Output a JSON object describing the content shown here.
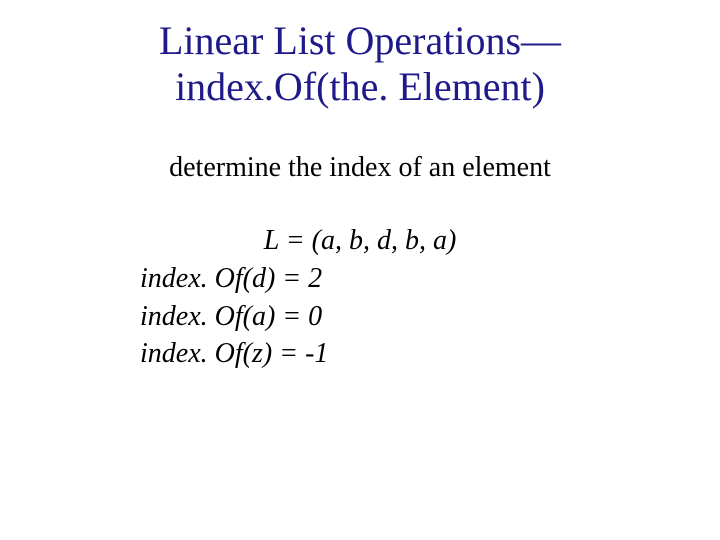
{
  "title_line1": "Linear List Operations—",
  "title_line2": "index.Of(the. Element)",
  "subhead": "determine the index of an element",
  "list_def": "L = (a, b, d, b, a)",
  "ex1": "index. Of(d) = 2",
  "ex2": "index. Of(a) = 0",
  "ex3": "index. Of(z) = -1"
}
